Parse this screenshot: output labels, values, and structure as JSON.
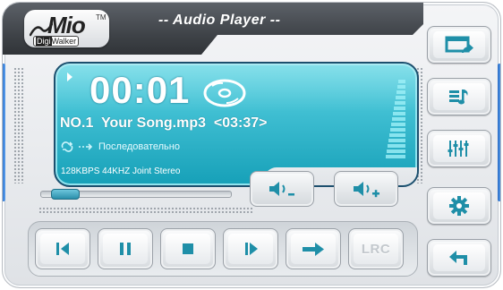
{
  "app": {
    "title": "-- Audio Player --",
    "brand": {
      "logo": "Mio",
      "trademark": "TM",
      "sub_dark": "Digi",
      "sub_light": "Walker"
    }
  },
  "display": {
    "elapsed": "00:01",
    "track_number": "NO.1",
    "track_title": "Your Song.mp3",
    "track_length": "<03:37>",
    "play_mode": "Последовательно",
    "bitrate_info": "128KBPS 44KHZ Joint Stereo",
    "progress_fraction": 0.05
  },
  "volume": {
    "down_icon": "volume-down-icon",
    "up_icon": "volume-up-icon"
  },
  "controls": [
    {
      "name": "previous-button",
      "icon": "skip-back-icon"
    },
    {
      "name": "pause-button",
      "icon": "pause-icon"
    },
    {
      "name": "stop-button",
      "icon": "stop-icon"
    },
    {
      "name": "next-button",
      "icon": "skip-forward-icon"
    },
    {
      "name": "repeat-mode-button",
      "icon": "arrow-right-icon"
    },
    {
      "name": "lyrics-button",
      "label": "LRC"
    }
  ],
  "side_buttons": [
    {
      "name": "open-folder-button",
      "icon": "folder-up-icon"
    },
    {
      "name": "playlist-button",
      "icon": "playlist-icon"
    },
    {
      "name": "equalizer-button",
      "icon": "equalizer-icon"
    },
    {
      "name": "settings-button",
      "icon": "gear-icon"
    },
    {
      "name": "back-button",
      "icon": "return-arrow-icon"
    }
  ],
  "colors": {
    "lcd_top": "#5fd6e4",
    "lcd_bottom": "#16a0b8",
    "accent_icon": "#1f8fa8",
    "title_bar": "#3e4247",
    "edge_blue": "#2b6cc4"
  }
}
